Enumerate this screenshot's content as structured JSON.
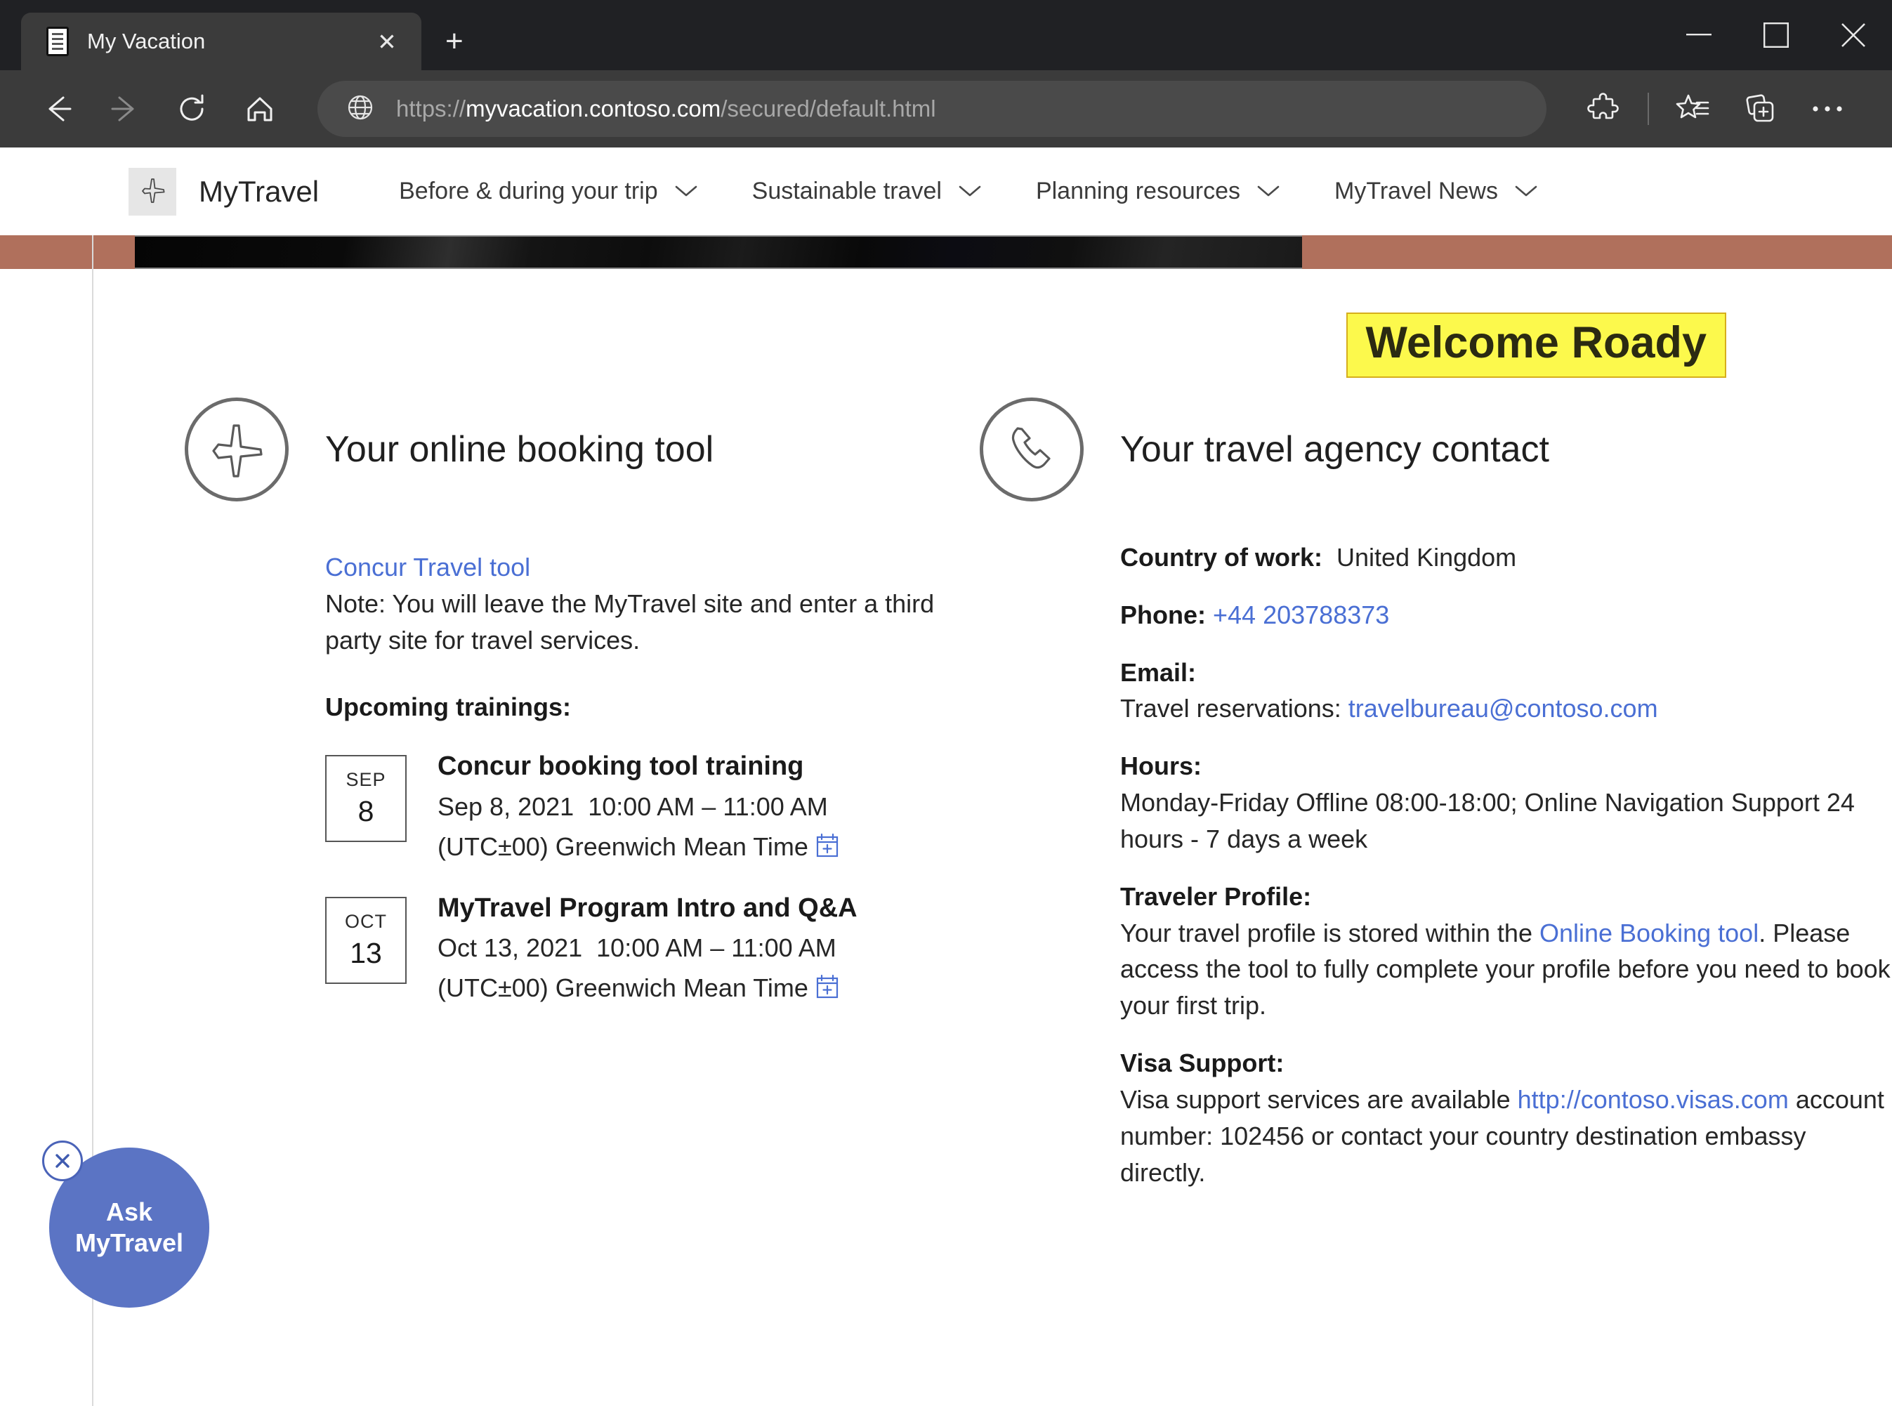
{
  "browser": {
    "tab": {
      "title": "My Vacation",
      "favicon_icon": "document-icon",
      "close_icon": "✕"
    },
    "new_tab_label": "+",
    "window_controls": {
      "minimize": "minimize-icon",
      "maximize": "maximize-icon",
      "close": "close-icon"
    },
    "nav": {
      "back": "back-arrow-icon",
      "forward": "forward-arrow-icon",
      "refresh": "refresh-icon",
      "home": "home-icon"
    },
    "address": {
      "globe_icon": "globe-icon",
      "scheme": "https://",
      "host": "myvacation.contoso.com",
      "path": "/secured/default.html",
      "full_url": "https://myvacation.contoso.com/secured/default.html"
    },
    "toolbar_right": {
      "extensions": "puzzle-piece-icon",
      "favorites": "star-list-icon",
      "collections": "collections-plus-icon",
      "settings_more": "ellipsis-icon"
    }
  },
  "site": {
    "brand": {
      "name": "MyTravel",
      "logo_icon": "airplane-icon"
    },
    "nav_items": [
      {
        "label": "Before & during your trip",
        "chevron": "chevron-down-icon"
      },
      {
        "label": "Sustainable travel",
        "chevron": "chevron-down-icon"
      },
      {
        "label": "Planning resources",
        "chevron": "chevron-down-icon"
      },
      {
        "label": "MyTravel News",
        "chevron": "chevron-down-icon"
      }
    ],
    "banner_color": "#b0705c"
  },
  "welcome": {
    "text": "Welcome Roady",
    "highlight_color": "#fcf94c",
    "border_color": "#d6ae1c"
  },
  "booking": {
    "icon": "airplane-circle-icon",
    "title": "Your online booking tool",
    "tool_link": "Concur Travel tool",
    "note": "Note: You will leave the MyTravel site and enter a third party site for travel services.",
    "trainings_heading": "Upcoming trainings:",
    "events": [
      {
        "month": "SEP",
        "day": "8",
        "title": "Concur booking tool training",
        "date": "Sep 8, 2021",
        "time": "10:00 AM – 11:00 AM",
        "timezone": "(UTC±00) Greenwich Mean Time",
        "calendar_icon": "add-to-calendar-icon"
      },
      {
        "month": "OCT",
        "day": "13",
        "title": "MyTravel Program Intro and Q&A",
        "date": "Oct 13, 2021",
        "time": "10:00 AM – 11:00 AM",
        "timezone": "(UTC±00) Greenwich Mean Time",
        "calendar_icon": "add-to-calendar-icon"
      }
    ]
  },
  "agency": {
    "icon": "phone-circle-icon",
    "title": "Your travel agency contact",
    "country_label": "Country of work:",
    "country_value": "United Kingdom",
    "phone_label": "Phone:",
    "phone_value": "+44 203788373",
    "email_label": "Email:",
    "email_prefix": "Travel reservations: ",
    "email_value": "travelbureau@contoso.com",
    "hours_label": "Hours:",
    "hours_value": "Monday-Friday Offline 08:00-18:00; Online Navigation Support 24 hours - 7 days a week",
    "profile_label": "Traveler Profile:",
    "profile_text_1": "Your travel profile is stored within the ",
    "profile_link": "Online Booking tool",
    "profile_text_2": ". Please access the tool to fully complete your profile before you need to book your first trip.",
    "visa_label": "Visa Support:",
    "visa_text_1": "Visa support services are available ",
    "visa_link": "http://contoso.visas.com",
    "visa_text_2": " account number: 102456 or contact your country destination embassy directly."
  },
  "ask_widget": {
    "line1": "Ask",
    "line2": "MyTravel",
    "close_icon": "close-icon",
    "color": "#5b74c4"
  }
}
